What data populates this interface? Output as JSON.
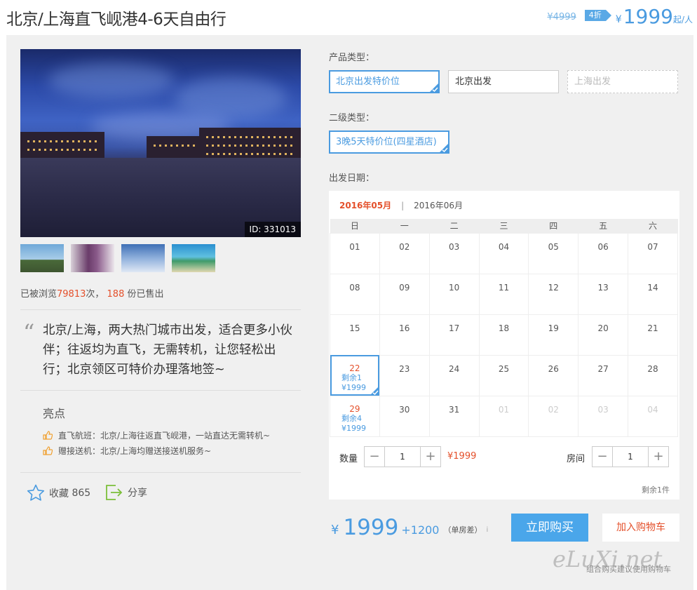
{
  "header": {
    "title": "北京/上海直飞岘港4-6天自由行",
    "old_price": "¥4999",
    "discount": "4折",
    "yen": "¥",
    "price": "1999",
    "price_unit": "起/人"
  },
  "gallery": {
    "id_tag": "ID: 331013"
  },
  "stats": {
    "prefix": "已被浏览",
    "views": "79813",
    "mid": "次，",
    "sold": "188",
    "suffix": "份已售出"
  },
  "quote": "北京/上海，两大热门城市出发，适合更多小伙伴；往返均为直飞，无需转机，让您轻松出行；北京领区可特价办理落地签~",
  "highlights": {
    "title": "亮点",
    "items": [
      {
        "label": "直飞航班：北京/上海往返直飞岘港，一站直达无需转机~",
        "icon": "thumbs-up-icon"
      },
      {
        "label": "赠接送机：北京/上海均赠送接送机服务~",
        "icon": "thumbs-up-icon"
      }
    ]
  },
  "actions": {
    "fav_label": "收藏",
    "fav_count": "865",
    "share_label": "分享"
  },
  "options": {
    "product_type_label": "产品类型：",
    "product_types": [
      "北京出发特价位",
      "北京出发",
      "上海出发"
    ],
    "sub_type_label": "二级类型：",
    "sub_types": [
      "3晚5天特价位(四星酒店)"
    ],
    "date_label": "出发日期："
  },
  "calendar": {
    "month_active": "2016年05月",
    "separator": "|",
    "month_next": "2016年06月",
    "weekdays": [
      "日",
      "一",
      "二",
      "三",
      "四",
      "五",
      "六"
    ],
    "weeks": [
      [
        {
          "d": "01"
        },
        {
          "d": "02"
        },
        {
          "d": "03"
        },
        {
          "d": "04"
        },
        {
          "d": "05"
        },
        {
          "d": "06"
        },
        {
          "d": "07"
        }
      ],
      [
        {
          "d": "08"
        },
        {
          "d": "09"
        },
        {
          "d": "10"
        },
        {
          "d": "11"
        },
        {
          "d": "12"
        },
        {
          "d": "13"
        },
        {
          "d": "14"
        }
      ],
      [
        {
          "d": "15"
        },
        {
          "d": "16"
        },
        {
          "d": "17"
        },
        {
          "d": "18"
        },
        {
          "d": "19"
        },
        {
          "d": "20"
        },
        {
          "d": "21"
        }
      ],
      [
        {
          "d": "22",
          "avail": true,
          "chosen": true,
          "left": "剩余1",
          "price": "¥1999"
        },
        {
          "d": "23"
        },
        {
          "d": "24"
        },
        {
          "d": "25"
        },
        {
          "d": "26"
        },
        {
          "d": "27"
        },
        {
          "d": "28"
        }
      ],
      [
        {
          "d": "29",
          "avail": true,
          "left": "剩余4",
          "price": "¥1999"
        },
        {
          "d": "30"
        },
        {
          "d": "31"
        },
        {
          "d": "01",
          "other": true
        },
        {
          "d": "02",
          "other": true
        },
        {
          "d": "03",
          "other": true
        },
        {
          "d": "04",
          "other": true
        }
      ]
    ],
    "qty_label": "数量",
    "qty_value": "1",
    "qty_price": "¥1999",
    "room_label": "房间",
    "room_value": "1",
    "remain": "剩余1件",
    "minus": "−",
    "plus": "+"
  },
  "footer": {
    "yen": "¥",
    "total": "1999",
    "extra": "+1200",
    "extra_note": "（单房差）",
    "info": "i",
    "buy": "立即购买",
    "cart": "加入购物车",
    "combo_tip": "组合购买建议使用购物车",
    "watermark": "eLuXi.net"
  },
  "colors": {
    "accent": "#4a9be0",
    "red": "#e4502b",
    "panel": "#f0f0f0"
  }
}
